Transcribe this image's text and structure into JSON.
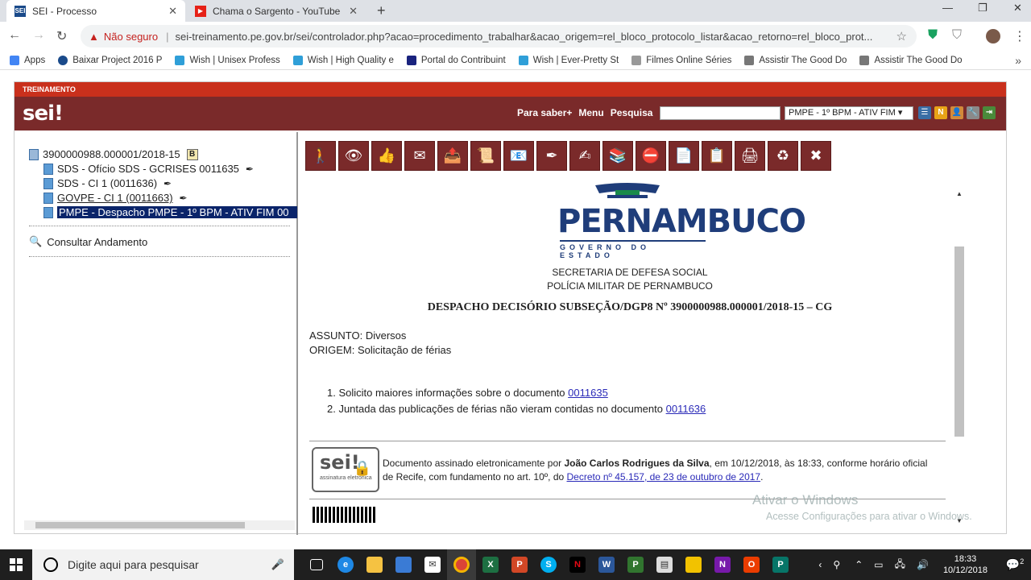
{
  "browser": {
    "tabs": [
      {
        "title": "SEI - Processo",
        "favicon": "SEI",
        "color": "#1a4a8a"
      },
      {
        "title": "Chama o Sargento - YouTube",
        "favicon": "▶",
        "color": "#e62117"
      }
    ],
    "new_tab": "+",
    "not_secure": "Não seguro",
    "url": "sei-treinamento.pe.gov.br/sei/controlador.php?acao=procedimento_trabalhar&acao_origem=rel_bloco_protocolo_listar&acao_retorno=rel_bloco_prot...",
    "bookmarks": [
      {
        "label": "Apps",
        "color": "#4285f4"
      },
      {
        "label": "Baixar Project 2016 P",
        "color": "#1a4a8a"
      },
      {
        "label": "Wish | Unisex Profess",
        "color": "#2f9fd8"
      },
      {
        "label": "Wish | High Quality e",
        "color": "#2f9fd8"
      },
      {
        "label": "Portal do Contribuint",
        "color": "#1a237e"
      },
      {
        "label": "Wish | Ever-Pretty St",
        "color": "#2f9fd8"
      },
      {
        "label": "Filmes Online Séries",
        "color": "#999999"
      },
      {
        "label": "Assistir The Good Do",
        "color": "#777777"
      },
      {
        "label": "Assistir The Good Do",
        "color": "#777777"
      }
    ]
  },
  "sei": {
    "env_label": "TREINAMENTO",
    "logo": "sei!",
    "menu": [
      "Para saber+",
      "Menu",
      "Pesquisa"
    ],
    "unit": "PMPE - 1º BPM - ATIV FIM ▾",
    "tree": {
      "process": "3900000988.000001/2018-15",
      "badge": "B",
      "docs": [
        {
          "label": "SDS - Ofício SDS - GCRISES 0011635"
        },
        {
          "label": "SDS - CI 1 (0011636)"
        },
        {
          "label": "GOVPE - CI 1 (0011663)"
        },
        {
          "label": "PMPE - Despacho PMPE - 1º BPM - ATIV FIM 00"
        }
      ],
      "consultar": "Consultar Andamento"
    },
    "document": {
      "state": "PERNAMBUCO",
      "state_sub": "GOVERNO DO ESTADO",
      "secretaria": "SECRETARIA DE DEFESA SOCIAL",
      "policia": "POLÍCIA MILITAR DE PERNAMBUCO",
      "title": "DESPACHO DECISÓRIO SUBSEÇÃO/DGP8 Nº 3900000988.000001/2018-15 – CG",
      "assunto": "ASSUNTO: Diversos",
      "origem": "ORIGEM: Solicitação de férias",
      "item1_text": "1. Solicito maiores informações sobre o documento ",
      "item1_link": "0011635",
      "item2_text": "2. Juntada das publicações de férias não vieram contidas no documento ",
      "item2_link": "0011636",
      "sig_logo": "sei!",
      "sig_logo_sub": "assinatura eletrônica",
      "sig_prefix": "Documento assinado eletronicamente por ",
      "sig_name": "João Carlos Rodrigues da Silva",
      "sig_suffix": ", em 10/12/2018, às 18:33, conforme horário oficial de Recife, com fundamento no art. 10º, do ",
      "sig_link": "Decreto nº 45.157, de 23 de outubro de 2017",
      "sig_end": "."
    }
  },
  "windows": {
    "watermark_title": "Ativar o Windows",
    "watermark_sub": "Acesse Configurações para ativar o Windows.",
    "search_placeholder": "Digite aqui para pesquisar",
    "time": "18:33",
    "date": "10/12/2018",
    "notifications": "2"
  }
}
